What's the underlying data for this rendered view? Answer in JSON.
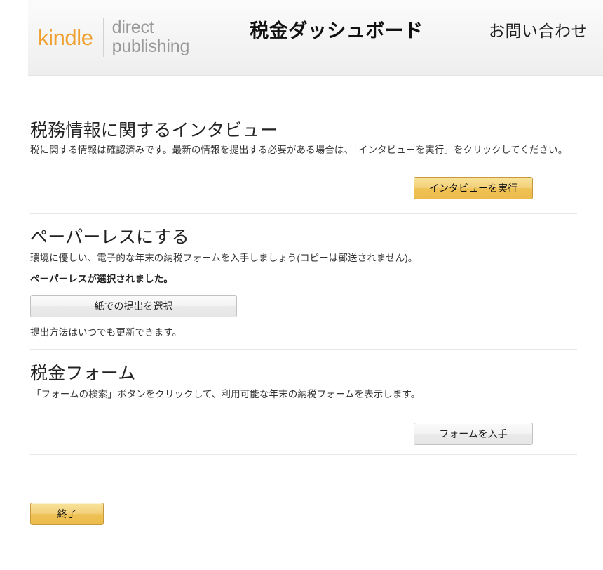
{
  "header": {
    "logo_kindle": "kindle",
    "logo_direct": "direct",
    "logo_publishing": "publishing",
    "title": "税金ダッシュボード",
    "contact_label": "お問い合わせ",
    "brand_color": "#f0a030",
    "logo_text_color": "#999999",
    "background": "#f2f2f2"
  },
  "sections": {
    "interview": {
      "title": "税務情報に関するインタビュー",
      "paragraph": "税に関する情報は確認済みです。最新の情報を提出する必要がある場合は、「インタビューを実行」をクリックしてください。",
      "button_label": "インタビューを実行"
    },
    "paperless": {
      "title": "ペーパーレスにする",
      "paragraph": "環境に優しい、電子的な年末の納税フォームを入手しましょう(コピーは郵送されません)。",
      "status": "ペーパーレスが選択されました。",
      "button_label": "紙での提出を選択",
      "note": "提出方法はいつでも更新できます。"
    },
    "tax_forms": {
      "title": "税金フォーム",
      "paragraph": "「フォームの検索」ボタンをクリックして、利用可能な年末の納税フォームを表示します。",
      "button_label": "フォームを入手"
    }
  },
  "footer": {
    "exit_label": "終了"
  },
  "colors": {
    "yellow_button": "#eec255",
    "yellow_button_border": "#c69a3c",
    "gray_button": "#efefef",
    "gray_button_border": "#c2c2c2",
    "divider": "#e7e7e7"
  }
}
